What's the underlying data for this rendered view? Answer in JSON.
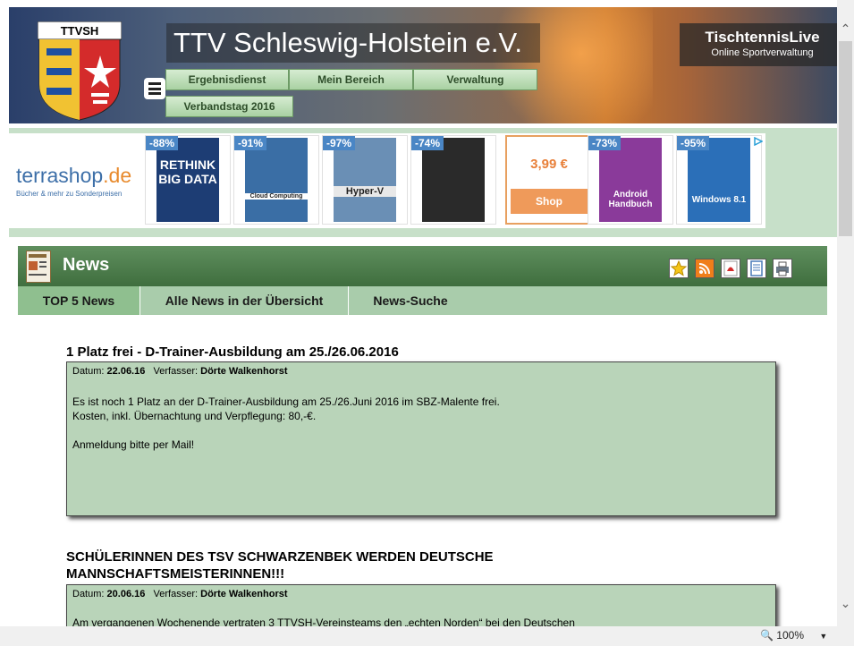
{
  "header": {
    "crest_label": "TTVSH",
    "title": "TTV Schleswig-Holstein e.V.",
    "badge_title": "TischtennisLive",
    "badge_subtitle": "Online Sportverwaltung",
    "nav": [
      "Ergebnisdienst",
      "Mein Bereich",
      "Verwaltung",
      "Verbandstag 2016"
    ]
  },
  "ad": {
    "brand_main": "terrashop",
    "brand_suffix": ".de",
    "tagline": "Bücher & mehr zu Sonderpreisen",
    "books": [
      {
        "discount": "-88%",
        "cover_text": "RETHINK BIG DATA",
        "color": "#1d3d74"
      },
      {
        "discount": "-91%",
        "cover_text": "Cloud Computing",
        "color": "#3a6ea5"
      },
      {
        "discount": "-97%",
        "cover_text": "Hyper-V",
        "color": "#6a8fb5"
      },
      {
        "discount": "-74%",
        "cover_text": "",
        "color": "#2a2a2a"
      },
      {
        "discount": "-73%",
        "cover_text": "Android Handbuch",
        "color": "#8a3a9a"
      },
      {
        "discount": "-95%",
        "cover_text": "Windows 8.1",
        "color": "#2b6fb8"
      }
    ],
    "shop_price": "3,99 €",
    "shop_button": "Shop"
  },
  "news": {
    "section_title": "News",
    "tabs": [
      "TOP 5 News",
      "Alle News in der Übersicht",
      "News-Suche"
    ],
    "articles": [
      {
        "title": "1 Platz frei - D-Trainer-Ausbildung am 25./26.06.2016",
        "date_label": "Datum:",
        "date": "22.06.16",
        "author_label": "Verfasser:",
        "author": "Dörte Walkenhorst",
        "lines": [
          "Es ist noch 1 Platz an der D-Trainer-Ausbildung am 25./26.Juni 2016 im SBZ-Malente frei.",
          "Kosten, inkl. Übernachtung und Verpflegung: 80,-€.",
          "Anmeldung bitte per Mail!"
        ]
      },
      {
        "title_line1": "SCHÜLERINNEN DES TSV SCHWARZENBEK WERDEN DEUTSCHE",
        "title_line2": "MANNSCHAFTSMEISTERINNEN!!!",
        "date_label": "Datum:",
        "date": "20.06.16",
        "author_label": "Verfasser:",
        "author": "Dörte Walkenhorst",
        "lines": [
          "Am vergangenen Wochenende vertraten 3 TTVSH-Vereinsteams den „echten Norden“ bei den Deutschen"
        ]
      }
    ]
  },
  "status": {
    "zoom": "100%"
  }
}
